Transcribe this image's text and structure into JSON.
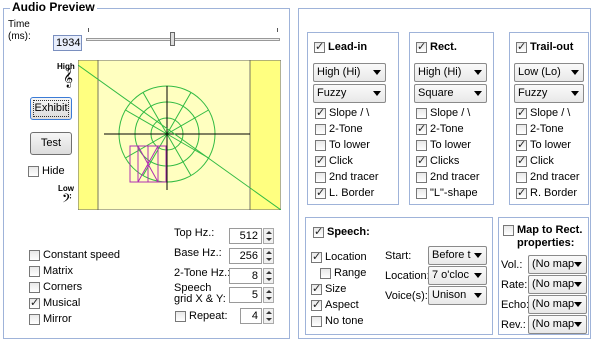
{
  "title": "Audio Preview",
  "time": {
    "label": "Time (ms):",
    "value": "1934"
  },
  "preview": {
    "high_label": "High",
    "low_label": "Low",
    "treble_icon": "treble-clef-icon",
    "bass_icon": "bass-clef-icon"
  },
  "buttons": {
    "exhibit": "Exhibit",
    "test": "Test"
  },
  "hide": {
    "label": "Hide",
    "checked": false
  },
  "left_checks": [
    {
      "label": "Constant speed",
      "checked": false
    },
    {
      "label": "Matrix",
      "checked": false
    },
    {
      "label": "Corners",
      "checked": false
    },
    {
      "label": "Musical",
      "checked": true
    },
    {
      "label": "Mirror",
      "checked": false
    }
  ],
  "spinners": {
    "top_hz": {
      "label": "Top Hz.:",
      "value": "512"
    },
    "base_hz": {
      "label": "Base Hz.:",
      "value": "256"
    },
    "two_tone_hz": {
      "label": "2-Tone Hz.:",
      "value": "8"
    },
    "speech_grid": {
      "label_line1": "Speech",
      "label_line2": "grid X & Y:",
      "value": "5"
    },
    "repeat": {
      "label": "Repeat:",
      "value": "4",
      "checked": false
    }
  },
  "lead_in": {
    "title": "Lead-in",
    "checked": true,
    "pitch": "High (Hi)",
    "shape": "Fuzzy",
    "checks": [
      {
        "label": "Slope / \\",
        "checked": true
      },
      {
        "label": "2-Tone",
        "checked": false
      },
      {
        "label": "To lower",
        "checked": false
      },
      {
        "label": "Click",
        "checked": true
      },
      {
        "label": "2nd tracer",
        "checked": false
      },
      {
        "label": "L. Border",
        "checked": true
      }
    ]
  },
  "rect": {
    "title": "Rect.",
    "checked": true,
    "pitch": "High (Hi)",
    "shape": "Square",
    "checks": [
      {
        "label": "Slope / \\",
        "checked": false
      },
      {
        "label": "2-Tone",
        "checked": true
      },
      {
        "label": "To lower",
        "checked": false
      },
      {
        "label": "Clicks",
        "checked": true
      },
      {
        "label": "2nd tracer",
        "checked": false
      },
      {
        "label": "\"L\"-shape",
        "checked": false
      }
    ]
  },
  "trail_out": {
    "title": "Trail-out",
    "checked": true,
    "pitch": "Low (Lo)",
    "shape": "Fuzzy",
    "checks": [
      {
        "label": "Slope / \\",
        "checked": true
      },
      {
        "label": "2-Tone",
        "checked": false
      },
      {
        "label": "To lower",
        "checked": true
      },
      {
        "label": "Click",
        "checked": true
      },
      {
        "label": "2nd tracer",
        "checked": false
      },
      {
        "label": "R. Border",
        "checked": true
      }
    ]
  },
  "speech": {
    "title": "Speech:",
    "checked": true,
    "checks": [
      {
        "label": "Location",
        "checked": true
      },
      {
        "label": "Range",
        "checked": false
      },
      {
        "label": "Size",
        "checked": true
      },
      {
        "label": "Aspect",
        "checked": true
      },
      {
        "label": "No tone",
        "checked": false
      }
    ],
    "start": {
      "label": "Start:",
      "value": "Before t"
    },
    "location": {
      "label": "Location:",
      "value": "7 o'cloc"
    },
    "voices": {
      "label": "Voice(s):",
      "value": "Unison"
    }
  },
  "map": {
    "title_line1": "Map to Rect.",
    "title_line2": "properties:",
    "checked": false,
    "rows": [
      {
        "label": "Vol.:",
        "value": "(No map"
      },
      {
        "label": "Rate:",
        "value": "(No map"
      },
      {
        "label": "Echo:",
        "value": "(No map"
      },
      {
        "label": "Rev.:",
        "value": "(No map"
      }
    ]
  },
  "colors": {
    "canvas": "#ffffc0",
    "border_band": "#ffff80",
    "shape": "#22bb44",
    "rect": "#b030b0",
    "panel_border": "#9fb3d9"
  }
}
